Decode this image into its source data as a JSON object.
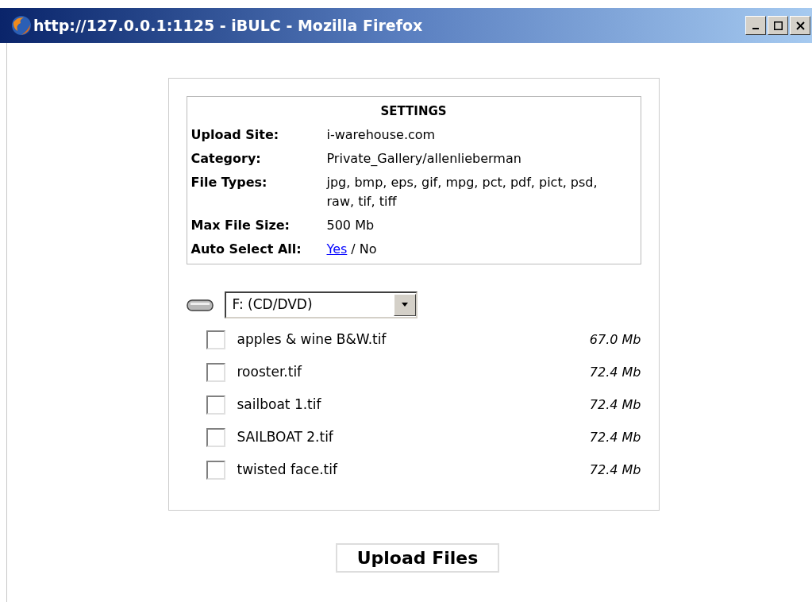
{
  "window": {
    "title": "http://127.0.0.1:1125 - iBULC - Mozilla Firefox"
  },
  "settings": {
    "heading": "SETTINGS",
    "rows": [
      {
        "label": "Upload Site:",
        "value": "i-warehouse.com"
      },
      {
        "label": "Category:",
        "value": "Private_Gallery/allenlieberman"
      },
      {
        "label": "File Types:",
        "value": "jpg, bmp, eps, gif, mpg, pct, pdf, pict, psd, raw, tif, tiff"
      },
      {
        "label": "Max File Size:",
        "value": "500 Mb"
      }
    ],
    "auto_select": {
      "label": "Auto Select All:",
      "separator": "/",
      "options": [
        {
          "label": "Yes",
          "selected": false
        },
        {
          "label": "No",
          "selected": true
        }
      ]
    }
  },
  "drive_select": {
    "value": "F: (CD/DVD)"
  },
  "files": [
    {
      "name": "apples & wine B&W.tif",
      "size": "67.0 Mb",
      "checked": false
    },
    {
      "name": "rooster.tif",
      "size": "72.4 Mb",
      "checked": false
    },
    {
      "name": "sailboat 1.tif",
      "size": "72.4 Mb",
      "checked": false
    },
    {
      "name": "SAILBOAT 2.tif",
      "size": "72.4 Mb",
      "checked": false
    },
    {
      "name": "twisted face.tif",
      "size": "72.4 Mb",
      "checked": false
    }
  ],
  "upload_button": "Upload Files"
}
